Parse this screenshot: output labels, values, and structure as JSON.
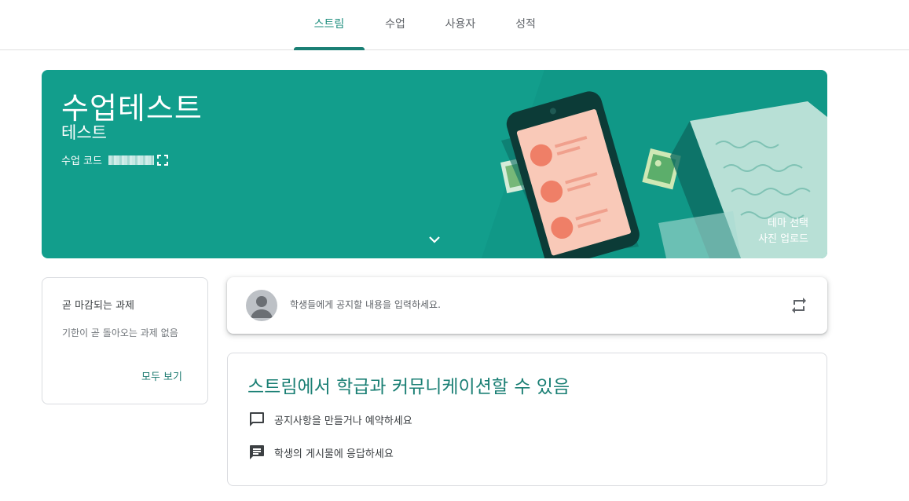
{
  "nav": {
    "tabs": [
      {
        "label": "스트림",
        "active": true
      },
      {
        "label": "수업",
        "active": false
      },
      {
        "label": "사용자",
        "active": false
      },
      {
        "label": "성적",
        "active": false
      }
    ]
  },
  "banner": {
    "title": "수업테스트",
    "section": "테스트",
    "code_label": "수업 코드",
    "select_theme": "테마 선택",
    "upload_photo": "사진 업로드",
    "color": "#129e8c"
  },
  "upcoming": {
    "title": "곧 마감되는 과제",
    "empty": "기한이 곧 돌아오는 과제 없음",
    "view_all": "모두 보기"
  },
  "announce": {
    "placeholder": "학생들에게 공지할 내용을 입력하세요."
  },
  "stream_info": {
    "title": "스트림에서 학급과 커뮤니케이션할 수 있음",
    "items": [
      {
        "icon": "comment-icon",
        "text": "공지사항을 만들거나 예약하세요"
      },
      {
        "icon": "feed-icon",
        "text": "학생의 게시물에 응답하세요"
      }
    ]
  },
  "colors": {
    "accent": "#1a7f74",
    "banner": "#129e8c"
  }
}
